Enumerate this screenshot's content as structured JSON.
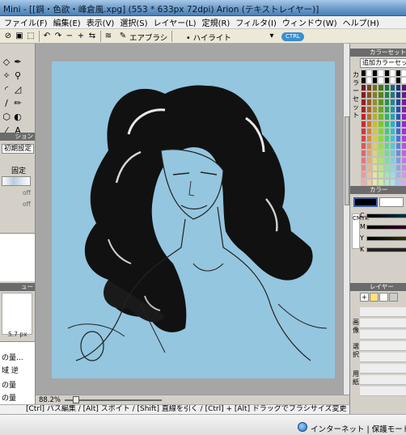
{
  "window": {
    "title": "Mini - [[鋼・色欲・峰倉風.xpg] (553 * 633px 72dpi)  Arion (テキストレイヤー)]"
  },
  "menu": [
    "ファイル(F)",
    "編集(E)",
    "表示(V)",
    "選択(S)",
    "レイヤー(L)",
    "定規(R)",
    "フィルタ(I)",
    "ウィンドウ(W)",
    "ヘルプ(H)"
  ],
  "toolbar": {
    "brush_label": "エアブラシ",
    "mode_label": "• ハイライト",
    "ctrl_label": "CTRL"
  },
  "left_panel": {
    "section_tool_option": "ション",
    "init_button": "初期設定",
    "fixed_label": "固定",
    "off_1": "off",
    "off_2": "off",
    "preview_header": "ュー",
    "brush_size": "5.7 px",
    "list_items": [
      "の量...",
      "域 逆",
      "の量",
      "の量"
    ]
  },
  "canvas": {
    "background": "#94c6df",
    "zoom": "88.2%"
  },
  "status": {
    "hint": "[Ctrl] パス編集 / [Alt] スポイト / [Shift] 直線を引く / [Ctrl] + [Alt] ドラッグでブラシサイズ変更"
  },
  "right_panel": {
    "colorset_header": "カラーセット",
    "colorset_name": "追加カラーセット",
    "colorset_vertical": "カラーセット",
    "color_header": "カラー",
    "cmyk_vertical": "CMYK",
    "sliders": [
      {
        "label": "C",
        "value": 0
      },
      {
        "label": "M",
        "value": 0
      },
      {
        "label": "Y",
        "value": 0
      },
      {
        "label": "K",
        "value": 100
      }
    ],
    "layer_header": "レイヤー",
    "layer_vertical": [
      "画像",
      "選択",
      "用紙"
    ]
  },
  "taskbar": {
    "status": "インターネット | 保護モード: 有"
  }
}
